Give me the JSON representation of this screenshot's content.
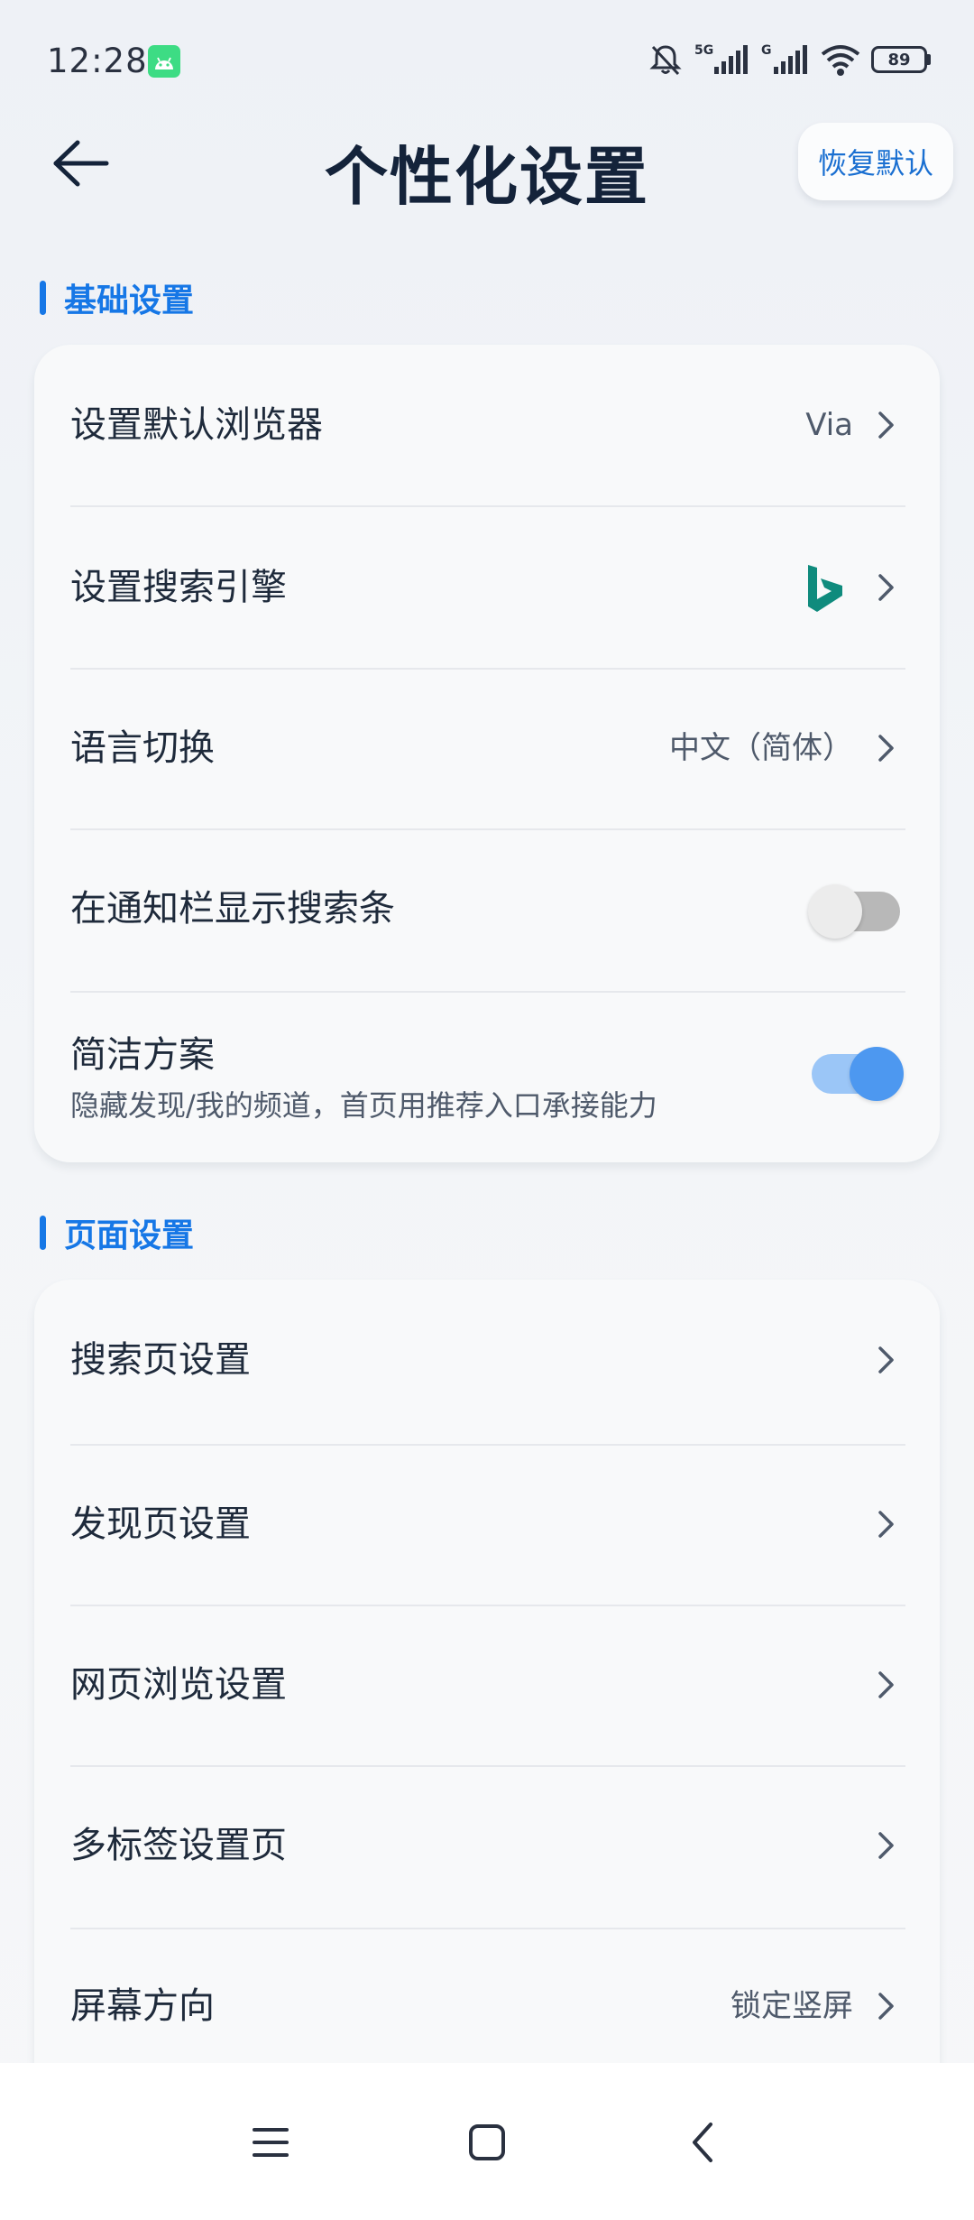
{
  "status_bar": {
    "time": "12:28",
    "battery": "89",
    "icons": [
      "android-notification-icon",
      "mute-bell-icon",
      "5g-signal-icon",
      "g-signal-icon",
      "wifi-icon",
      "battery-icon"
    ]
  },
  "header": {
    "title": "个性化设置",
    "restore_label": "恢复默认",
    "back_icon": "arrow-left-icon"
  },
  "sections": {
    "basic": {
      "label": "基础设置",
      "rows": {
        "default_browser": {
          "label": "设置默认浏览器",
          "value": "Via"
        },
        "search_engine": {
          "label": "设置搜索引擎",
          "value_icon": "bing-icon"
        },
        "language": {
          "label": "语言切换",
          "value": "中文（简体）"
        },
        "notify_search": {
          "label": "在通知栏显示搜索条",
          "enabled": false
        },
        "simple_mode": {
          "label": "简洁方案",
          "sublabel": "隐藏发现/我的频道，首页用推荐入口承接能力",
          "enabled": true
        }
      }
    },
    "page": {
      "label": "页面设置",
      "rows": {
        "search_page": {
          "label": "搜索页设置"
        },
        "discover_page": {
          "label": "发现页设置"
        },
        "web_browsing": {
          "label": "网页浏览设置"
        },
        "multi_tab": {
          "label": "多标签设置页"
        },
        "screen_orientation": {
          "label": "屏幕方向",
          "value": "锁定竖屏"
        }
      }
    }
  },
  "colors": {
    "accent": "#1677e6",
    "toggle_on_knob": "#4d98f0",
    "toggle_on_track": "#9bc6f7",
    "toggle_off_track": "#b8b8b8",
    "bing": "#0f8b7d"
  },
  "nav_bar": {
    "icons": [
      "menu-icon",
      "home-square-icon",
      "back-chevron-icon"
    ]
  }
}
